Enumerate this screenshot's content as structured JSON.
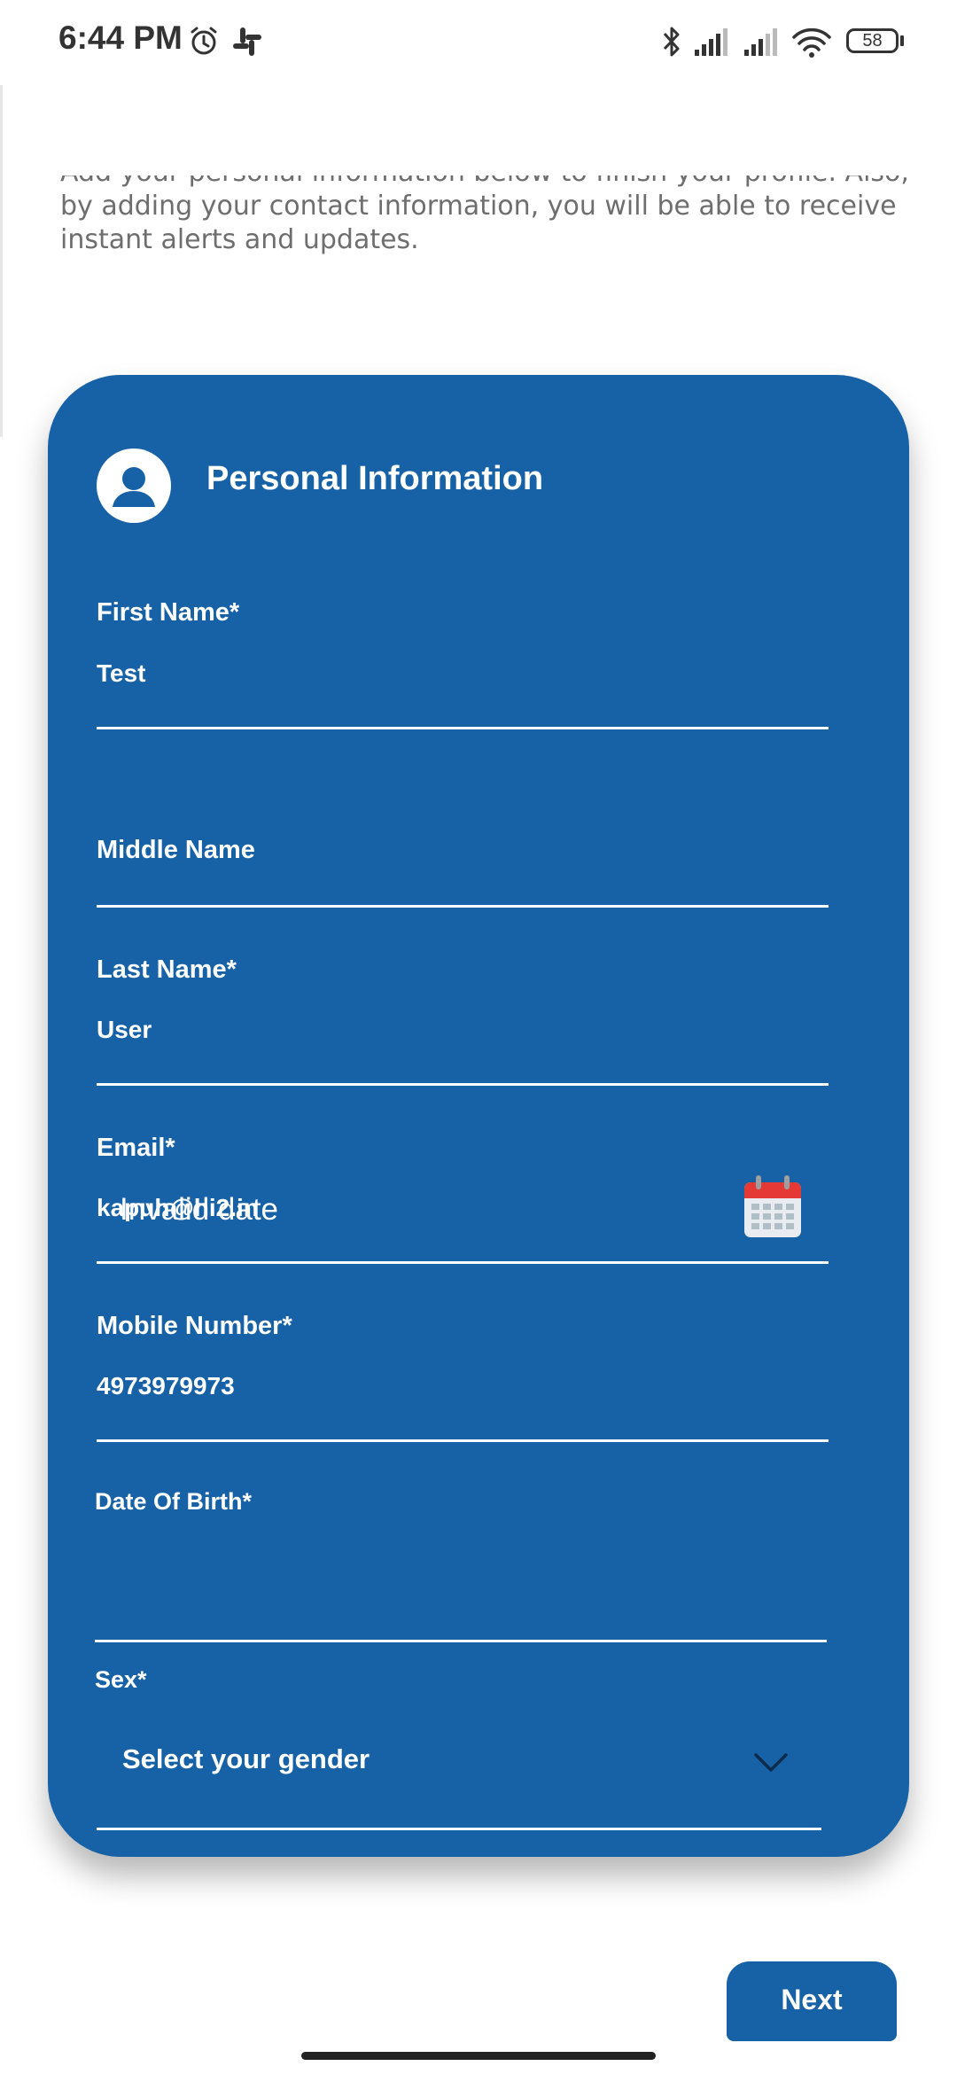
{
  "status_bar": {
    "time": "6:44 PM",
    "battery": "58",
    "icons": [
      "alarm-icon",
      "slack-icon",
      "bluetooth-icon",
      "signal-icon",
      "signal-icon",
      "wifi-icon",
      "battery-icon"
    ]
  },
  "intro": {
    "text": "Add your personal information below to finish your profile. Also, by adding your contact information, you will be able to receive instant alerts and updates."
  },
  "card": {
    "title": "Personal Information",
    "icon": "user-icon",
    "color": "#1761a6"
  },
  "form": {
    "first_name": {
      "label": "First Name*",
      "value": "Test"
    },
    "middle_name": {
      "label": "Middle Name",
      "value": ""
    },
    "last_name": {
      "label": "Last Name*",
      "value": "User"
    },
    "email": {
      "label": "Email*",
      "value": "kapuh@hi2.in"
    },
    "mobile": {
      "label": "Mobile Number*",
      "value": "4973979973"
    },
    "dob": {
      "label": "Date Of Birth*",
      "value": "Invalid date",
      "icon": "calendar-icon"
    },
    "sex": {
      "label": "Sex*",
      "value": "Select your gender",
      "icon": "chevron-down-icon"
    }
  },
  "footer": {
    "next_label": "Next"
  }
}
